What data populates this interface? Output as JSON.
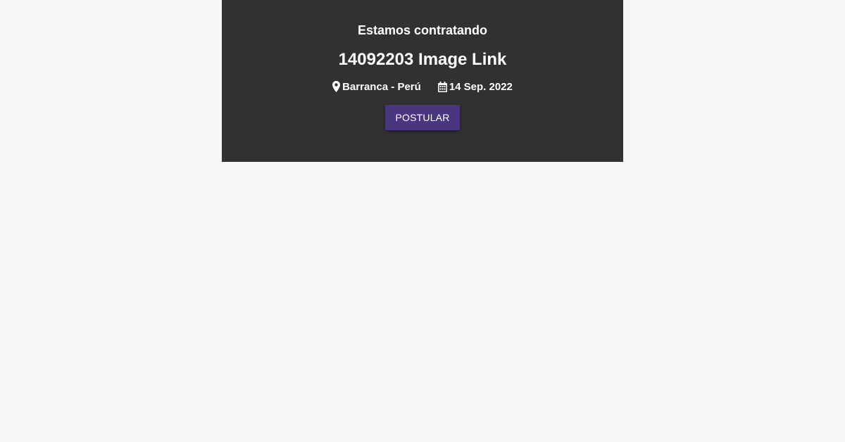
{
  "card": {
    "background": "#313131",
    "eyebrow": "Estamos contratando",
    "title": "14092203 Image Link",
    "location": {
      "icon": "map-marker-icon",
      "text": "Barranca - Perú"
    },
    "date": {
      "icon": "calendar-icon",
      "text": "14 Sep. 2022"
    },
    "apply_button": {
      "label": "POSTULAR",
      "color": "#4a3580"
    }
  },
  "page": {
    "background": "#f7f7f7"
  }
}
